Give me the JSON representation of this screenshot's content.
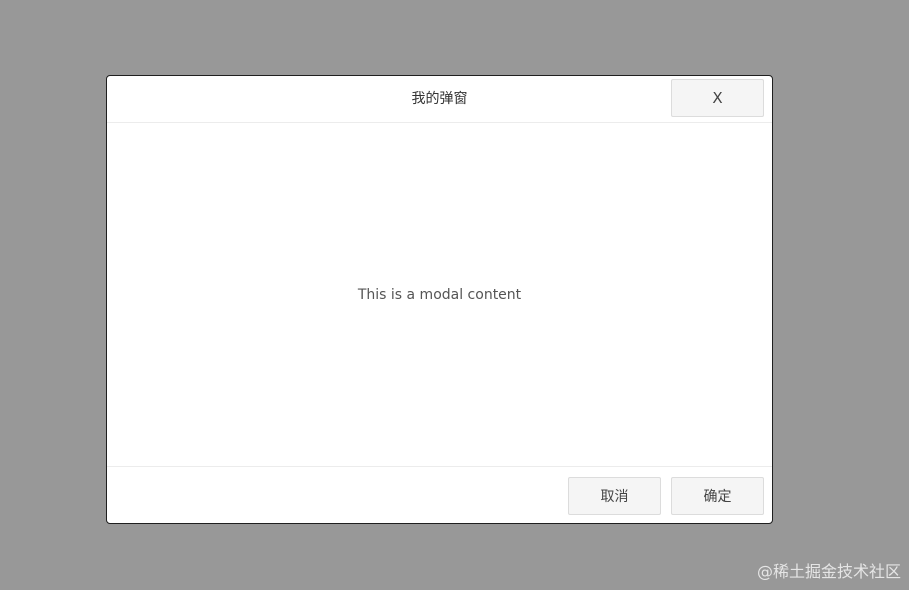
{
  "modal": {
    "title": "我的弹窗",
    "close_label": "X",
    "content": "This is a modal content",
    "cancel_label": "取消",
    "confirm_label": "确定"
  },
  "watermark": {
    "text": "@稀土掘金技术社区"
  },
  "colors": {
    "overlay": "#989898",
    "modal_background": "#ffffff",
    "button_background": "#f5f5f5"
  }
}
